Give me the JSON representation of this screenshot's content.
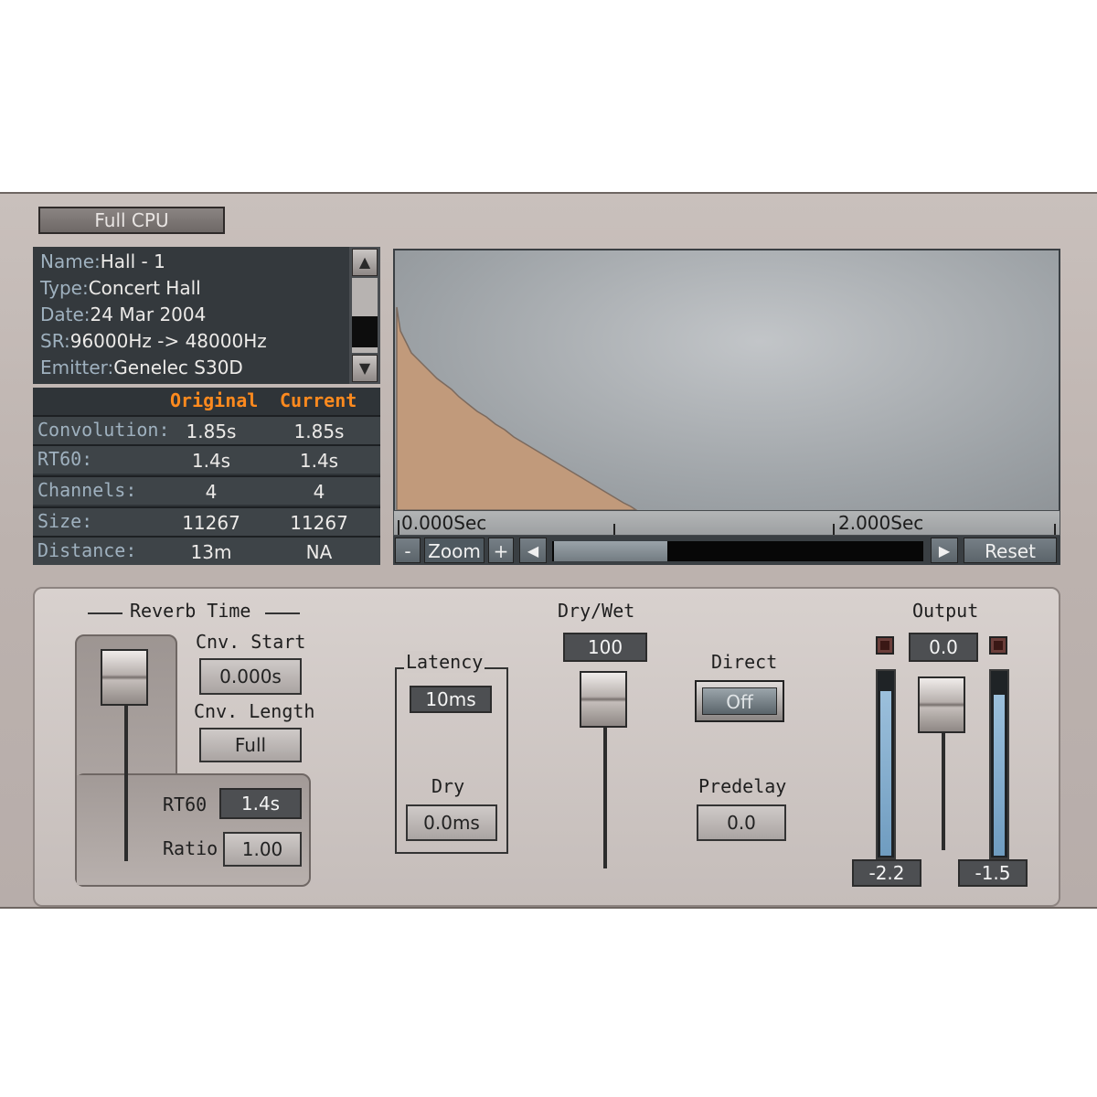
{
  "top": {
    "cpu_button": "Full CPU"
  },
  "info": {
    "rows": [
      {
        "label": "Name:",
        "value": "Hall - 1"
      },
      {
        "label": "Type:",
        "value": "Concert Hall"
      },
      {
        "label": "Date:",
        "value": "24 Mar 2004"
      },
      {
        "label": "SR:",
        "value": "96000Hz -> 48000Hz"
      },
      {
        "label": "Emitter:",
        "value": "Genelec S30D"
      }
    ],
    "scroll_up": "▲",
    "scroll_down": "▼"
  },
  "stats": {
    "headers": {
      "original": "Original",
      "current": "Current"
    },
    "rows": [
      {
        "label": "Convolution:",
        "original": "1.85s",
        "current": "1.85s"
      },
      {
        "label": "RT60:",
        "original": "1.4s",
        "current": "1.4s"
      },
      {
        "label": "Channels:",
        "original": "4",
        "current": "4"
      },
      {
        "label": "Size:",
        "original": "11267",
        "current": "11267"
      },
      {
        "label": "Distance:",
        "original": "13m",
        "current": "NA"
      }
    ]
  },
  "waveform": {
    "start_time": "0.000Sec",
    "mid_time": "2.000Sec",
    "fill_color": "#c19a7b"
  },
  "zoom": {
    "minus": "-",
    "label": "Zoom",
    "plus": "+",
    "left_arrow": "◀",
    "right_arrow": "▶",
    "reset": "Reset"
  },
  "reverb_time": {
    "title": "Reverb Time",
    "cnv_start_label": "Cnv. Start",
    "cnv_start_value": "0.000s",
    "cnv_length_label": "Cnv. Length",
    "cnv_length_value": "Full",
    "rt60_label": "RT60",
    "rt60_value": "1.4s",
    "ratio_label": "Ratio",
    "ratio_value": "1.00"
  },
  "latency": {
    "title": "Latency",
    "value": "10ms",
    "dry_label": "Dry",
    "dry_value": "0.0ms"
  },
  "dry_wet": {
    "label": "Dry/Wet",
    "value": "100"
  },
  "direct": {
    "label": "Direct",
    "value": "Off"
  },
  "predelay": {
    "label": "Predelay",
    "value": "0.0"
  },
  "output": {
    "label": "Output",
    "value": "0.0",
    "left_meter": "-2.2",
    "right_meter": "-1.5",
    "meter_color": "#6f9cc0"
  }
}
